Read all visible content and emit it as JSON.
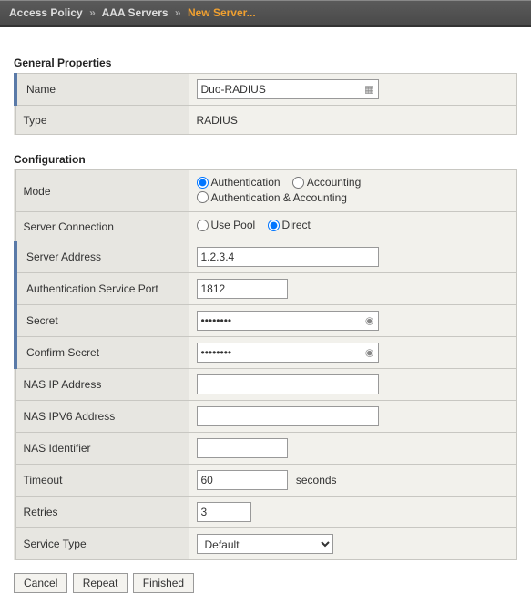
{
  "breadcrumb": {
    "part1": "Access Policy",
    "sep": "»",
    "part2": "AAA Servers",
    "current": "New Server..."
  },
  "section_general": "General Properties",
  "general": {
    "name_label": "Name",
    "name_value": "Duo-RADIUS",
    "type_label": "Type",
    "type_value": "RADIUS"
  },
  "section_config": "Configuration",
  "config": {
    "mode_label": "Mode",
    "mode_opts": {
      "auth": "Authentication",
      "acct": "Accounting",
      "both": "Authentication & Accounting"
    },
    "server_conn_label": "Server Connection",
    "server_conn_opts": {
      "pool": "Use Pool",
      "direct": "Direct"
    },
    "server_address_label": "Server Address",
    "server_address_value": "1.2.3.4",
    "auth_port_label": "Authentication Service Port",
    "auth_port_value": "1812",
    "secret_label": "Secret",
    "secret_value": "••••••••",
    "confirm_secret_label": "Confirm Secret",
    "confirm_secret_value": "••••••••",
    "nas_ip_label": "NAS IP Address",
    "nas_ip_value": "",
    "nas_ipv6_label": "NAS IPV6 Address",
    "nas_ipv6_value": "",
    "nas_identifier_label": "NAS Identifier",
    "nas_identifier_value": "",
    "timeout_label": "Timeout",
    "timeout_value": "60",
    "timeout_unit": "seconds",
    "retries_label": "Retries",
    "retries_value": "3",
    "service_type_label": "Service Type",
    "service_type_value": "Default"
  },
  "buttons": {
    "cancel": "Cancel",
    "repeat": "Repeat",
    "finished": "Finished"
  }
}
